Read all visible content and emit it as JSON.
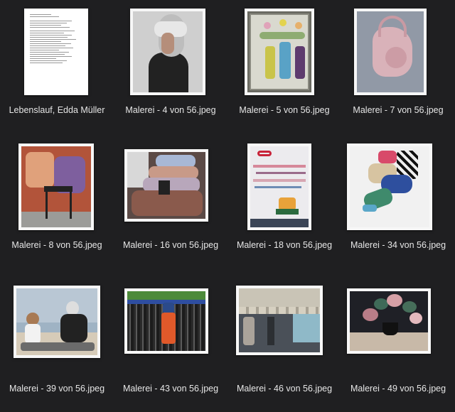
{
  "files": [
    {
      "name": "Lebenslauf, Edda Müller",
      "kind": "document",
      "icon": "document-icon"
    },
    {
      "name": "Malerei - 4 von 56.jpeg",
      "kind": "image",
      "icon": "painting-woman-headscarf"
    },
    {
      "name": "Malerei - 5 von 56.jpeg",
      "kind": "image",
      "icon": "painting-tulips-bottles"
    },
    {
      "name": "Malerei - 7 von 56.jpeg",
      "kind": "image",
      "icon": "painting-pink-bag"
    },
    {
      "name": "Malerei - 8 von 56.jpeg",
      "kind": "image",
      "icon": "painting-chair-clothes"
    },
    {
      "name": "Malerei - 16 von 56.jpeg",
      "kind": "image",
      "icon": "painting-pillow-stack"
    },
    {
      "name": "Malerei - 18 von 56.jpeg",
      "kind": "image",
      "icon": "painting-abstract-reflection"
    },
    {
      "name": "Malerei - 34 von 56.jpeg",
      "kind": "image",
      "icon": "painting-fabric-still-life"
    },
    {
      "name": "Malerei - 39 von 56.jpeg",
      "kind": "image",
      "icon": "painting-beach-figures"
    },
    {
      "name": "Malerei - 43 von 56.jpeg",
      "kind": "image",
      "icon": "painting-child-wall"
    },
    {
      "name": "Malerei - 46 von 56.jpeg",
      "kind": "image",
      "icon": "painting-awning-facade"
    },
    {
      "name": "Malerei - 49 von 56.jpeg",
      "kind": "image",
      "icon": "painting-flower-pot"
    }
  ],
  "colors": {
    "background": "#1f1f21",
    "label_text": "#e6e6e6",
    "thumb_frame": "#f7f7f7"
  }
}
